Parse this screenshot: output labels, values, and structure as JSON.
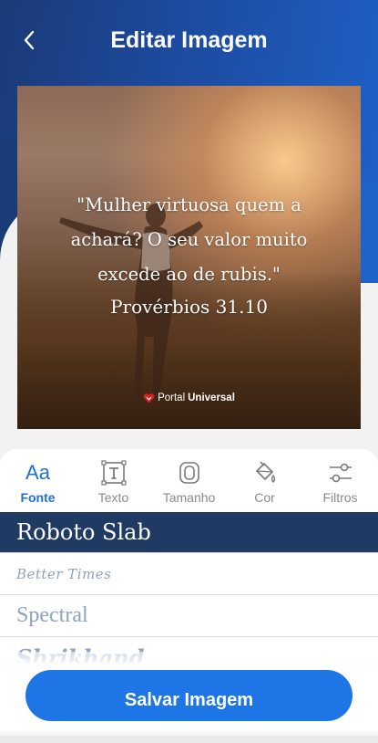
{
  "header": {
    "title": "Editar Imagem",
    "gradient_colors": [
      "#1b3a78",
      "#1f62c8"
    ]
  },
  "preview": {
    "quote_lines": [
      "\"Mulher virtuosa quem a",
      "achará? O seu valor muito",
      "excede ao de rubis.\""
    ],
    "reference": "Provérbios 31.10",
    "watermark_brand": "Portal",
    "watermark_name": "Universal"
  },
  "toolbar": {
    "items": [
      {
        "label": "Fonte",
        "icon": "font-aa-icon",
        "glyph": "Aa",
        "active": true
      },
      {
        "label": "Texto",
        "icon": "text-box-icon",
        "active": false
      },
      {
        "label": "Tamanho",
        "icon": "resize-icon",
        "active": false
      },
      {
        "label": "Cor",
        "icon": "paint-bucket-icon",
        "active": false
      },
      {
        "label": "Filtros",
        "icon": "sliders-icon",
        "active": false
      }
    ],
    "accent": "#1e6fd9"
  },
  "fonts": {
    "items": [
      "Roboto Slab",
      "Better Times",
      "Spectral",
      "Shrikhand"
    ],
    "selected": "Roboto Slab",
    "selected_bg": "#1f3a63"
  },
  "actions": {
    "save_label": "Salvar Imagem",
    "save_color": "#1e76e6"
  }
}
